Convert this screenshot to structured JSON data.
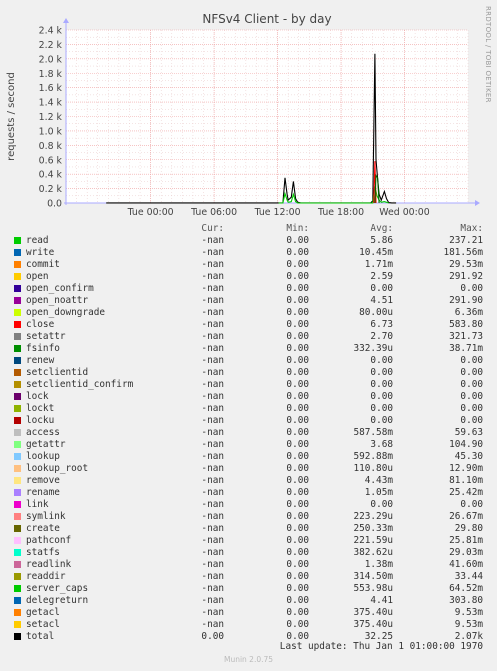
{
  "chart_data": {
    "type": "line",
    "title": "NFSv4 Client - by day",
    "ylabel": "requests / second",
    "side_label": "RRDTOOL / TOBI OETIKER",
    "ylim": [
      0,
      2400
    ],
    "y_ticks": [
      {
        "value": 0,
        "label": "0.0"
      },
      {
        "value": 200,
        "label": "0.2 k"
      },
      {
        "value": 400,
        "label": "0.4 k"
      },
      {
        "value": 600,
        "label": "0.6 k"
      },
      {
        "value": 800,
        "label": "0.8 k"
      },
      {
        "value": 1000,
        "label": "1.0 k"
      },
      {
        "value": 1200,
        "label": "1.2 k"
      },
      {
        "value": 1400,
        "label": "1.4 k"
      },
      {
        "value": 1600,
        "label": "1.6 k"
      },
      {
        "value": 1800,
        "label": "1.8 k"
      },
      {
        "value": 2000,
        "label": "2.0 k"
      },
      {
        "value": 2200,
        "label": "2.2 k"
      },
      {
        "value": 2400,
        "label": "2.4 k"
      }
    ],
    "xlim": [
      -8,
      30
    ],
    "x_ticks": [
      {
        "value": 0,
        "label": "Tue 00:00"
      },
      {
        "value": 6,
        "label": "Tue 06:00"
      },
      {
        "value": 12,
        "label": "Tue 12:00"
      },
      {
        "value": 18,
        "label": "Tue 18:00"
      },
      {
        "value": 24,
        "label": "Wed 00:00"
      }
    ],
    "x_unit": "hours since Tue 00:00",
    "grid": true,
    "series": [
      {
        "name": "total",
        "color": "#000000",
        "points": [
          [
            -4.2,
            1
          ],
          [
            -3.8,
            1
          ],
          [
            -3.4,
            1
          ],
          [
            12.1,
            1
          ],
          [
            12.5,
            2
          ],
          [
            12.7,
            350
          ],
          [
            12.9,
            120
          ],
          [
            13.0,
            40
          ],
          [
            13.3,
            80
          ],
          [
            13.5,
            300
          ],
          [
            13.7,
            60
          ],
          [
            13.9,
            10
          ],
          [
            14.2,
            2
          ],
          [
            15.5,
            1
          ],
          [
            16.5,
            1
          ],
          [
            20.5,
            1
          ],
          [
            20.8,
            2
          ],
          [
            21.0,
            30
          ],
          [
            21.2,
            2070
          ],
          [
            21.3,
            600
          ],
          [
            21.45,
            340
          ],
          [
            21.6,
            120
          ],
          [
            21.8,
            40
          ],
          [
            22.1,
            160
          ],
          [
            22.3,
            60
          ],
          [
            22.5,
            5
          ],
          [
            22.8,
            1
          ],
          [
            23.2,
            1
          ]
        ]
      },
      {
        "name": "read",
        "color": "#00cc00",
        "points": [
          [
            12.1,
            0
          ],
          [
            12.5,
            0
          ],
          [
            12.7,
            130
          ],
          [
            12.9,
            40
          ],
          [
            13.0,
            10
          ],
          [
            13.3,
            20
          ],
          [
            13.5,
            120
          ],
          [
            13.7,
            20
          ],
          [
            13.9,
            0
          ],
          [
            20.8,
            0
          ],
          [
            21.0,
            0
          ],
          [
            21.2,
            230
          ],
          [
            21.4,
            100
          ],
          [
            21.6,
            40
          ],
          [
            21.8,
            10
          ],
          [
            22.1,
            20
          ],
          [
            22.5,
            0
          ]
        ]
      },
      {
        "name": "close",
        "color": "#ff0000",
        "points": [
          [
            21.1,
            0
          ],
          [
            21.2,
            580
          ],
          [
            21.3,
            0
          ]
        ]
      },
      {
        "name": "fsinfo",
        "color": "#006600",
        "points": [
          [
            21.2,
            0
          ],
          [
            21.3,
            380
          ],
          [
            21.45,
            350
          ],
          [
            21.6,
            0
          ]
        ]
      }
    ]
  },
  "legend": {
    "headers": {
      "cur": "Cur:",
      "min": "Min:",
      "avg": "Avg:",
      "max": "Max:"
    },
    "rows": [
      {
        "name": "read",
        "color": "#00cc00",
        "cur": "-nan",
        "min": "0.00",
        "avg": "5.86",
        "max": "237.21"
      },
      {
        "name": "write",
        "color": "#0066b3",
        "cur": "-nan",
        "min": "0.00",
        "avg": "10.45m",
        "max": "181.56m"
      },
      {
        "name": "commit",
        "color": "#ff8000",
        "cur": "-nan",
        "min": "0.00",
        "avg": "1.71m",
        "max": "29.53m"
      },
      {
        "name": "open",
        "color": "#ffcc00",
        "cur": "-nan",
        "min": "0.00",
        "avg": "2.59",
        "max": "291.92"
      },
      {
        "name": "open_confirm",
        "color": "#330099",
        "cur": "-nan",
        "min": "0.00",
        "avg": "0.00",
        "max": "0.00"
      },
      {
        "name": "open_noattr",
        "color": "#990099",
        "cur": "-nan",
        "min": "0.00",
        "avg": "4.51",
        "max": "291.90"
      },
      {
        "name": "open_downgrade",
        "color": "#ccff00",
        "cur": "-nan",
        "min": "0.00",
        "avg": "80.00u",
        "max": "6.36m"
      },
      {
        "name": "close",
        "color": "#ff0000",
        "cur": "-nan",
        "min": "0.00",
        "avg": "6.73",
        "max": "583.80"
      },
      {
        "name": "setattr",
        "color": "#808080",
        "cur": "-nan",
        "min": "0.00",
        "avg": "2.70",
        "max": "321.73"
      },
      {
        "name": "fsinfo",
        "color": "#008f00",
        "cur": "-nan",
        "min": "0.00",
        "avg": "332.39u",
        "max": "38.71m"
      },
      {
        "name": "renew",
        "color": "#00487d",
        "cur": "-nan",
        "min": "0.00",
        "avg": "0.00",
        "max": "0.00"
      },
      {
        "name": "setclientid",
        "color": "#b35a00",
        "cur": "-nan",
        "min": "0.00",
        "avg": "0.00",
        "max": "0.00"
      },
      {
        "name": "setclientid_confirm",
        "color": "#b38f00",
        "cur": "-nan",
        "min": "0.00",
        "avg": "0.00",
        "max": "0.00"
      },
      {
        "name": "lock",
        "color": "#6b006b",
        "cur": "-nan",
        "min": "0.00",
        "avg": "0.00",
        "max": "0.00"
      },
      {
        "name": "lockt",
        "color": "#8fb300",
        "cur": "-nan",
        "min": "0.00",
        "avg": "0.00",
        "max": "0.00"
      },
      {
        "name": "locku",
        "color": "#b30000",
        "cur": "-nan",
        "min": "0.00",
        "avg": "0.00",
        "max": "0.00"
      },
      {
        "name": "access",
        "color": "#bebebe",
        "cur": "-nan",
        "min": "0.00",
        "avg": "587.58m",
        "max": "59.63"
      },
      {
        "name": "getattr",
        "color": "#80ff80",
        "cur": "-nan",
        "min": "0.00",
        "avg": "3.68",
        "max": "104.90"
      },
      {
        "name": "lookup",
        "color": "#80c9ff",
        "cur": "-nan",
        "min": "0.00",
        "avg": "592.88m",
        "max": "45.30"
      },
      {
        "name": "lookup_root",
        "color": "#ffc080",
        "cur": "-nan",
        "min": "0.00",
        "avg": "110.80u",
        "max": "12.90m"
      },
      {
        "name": "remove",
        "color": "#ffe680",
        "cur": "-nan",
        "min": "0.00",
        "avg": "4.43m",
        "max": "81.10m"
      },
      {
        "name": "rename",
        "color": "#aa80ff",
        "cur": "-nan",
        "min": "0.00",
        "avg": "1.05m",
        "max": "25.42m"
      },
      {
        "name": "link",
        "color": "#ee00cc",
        "cur": "-nan",
        "min": "0.00",
        "avg": "0.00",
        "max": "0.00"
      },
      {
        "name": "symlink",
        "color": "#ff8080",
        "cur": "-nan",
        "min": "0.00",
        "avg": "223.29u",
        "max": "26.67m"
      },
      {
        "name": "create",
        "color": "#666600",
        "cur": "-nan",
        "min": "0.00",
        "avg": "250.33m",
        "max": "29.80"
      },
      {
        "name": "pathconf",
        "color": "#ffbfff",
        "cur": "-nan",
        "min": "0.00",
        "avg": "221.59u",
        "max": "25.81m"
      },
      {
        "name": "statfs",
        "color": "#00ffcc",
        "cur": "-nan",
        "min": "0.00",
        "avg": "382.62u",
        "max": "29.03m"
      },
      {
        "name": "readlink",
        "color": "#cc6699",
        "cur": "-nan",
        "min": "0.00",
        "avg": "1.38m",
        "max": "41.60m"
      },
      {
        "name": "readdir",
        "color": "#999900",
        "cur": "-nan",
        "min": "0.00",
        "avg": "314.50m",
        "max": "33.44"
      },
      {
        "name": "server_caps",
        "color": "#00cc00",
        "cur": "-nan",
        "min": "0.00",
        "avg": "553.98u",
        "max": "64.52m"
      },
      {
        "name": "delegreturn",
        "color": "#0066b3",
        "cur": "-nan",
        "min": "0.00",
        "avg": "4.41",
        "max": "303.80"
      },
      {
        "name": "getacl",
        "color": "#ff8000",
        "cur": "-nan",
        "min": "0.00",
        "avg": "375.40u",
        "max": "9.53m"
      },
      {
        "name": "setacl",
        "color": "#ffcc00",
        "cur": "-nan",
        "min": "0.00",
        "avg": "375.40u",
        "max": "9.53m"
      },
      {
        "name": "total",
        "color": "#000000",
        "cur": "0.00",
        "min": "0.00",
        "avg": "32.25",
        "max": "2.07k"
      }
    ]
  },
  "footer": {
    "last_update": "Last update: Thu Jan  1 01:00:00 1970",
    "munin_version": "Munin 2.0.75"
  }
}
